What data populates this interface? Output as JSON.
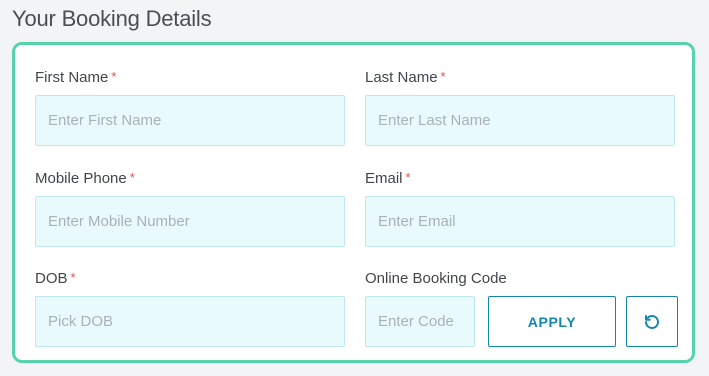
{
  "page": {
    "title": "Your Booking Details"
  },
  "form": {
    "required_marker": "*",
    "first_name": {
      "label": "First Name",
      "placeholder": "Enter First Name",
      "required": true
    },
    "last_name": {
      "label": "Last Name",
      "placeholder": "Enter Last Name",
      "required": true
    },
    "mobile_phone": {
      "label": "Mobile Phone",
      "placeholder": "Enter Mobile Number",
      "required": true
    },
    "email": {
      "label": "Email",
      "placeholder": "Enter Email",
      "required": true
    },
    "dob": {
      "label": "DOB",
      "placeholder": "Pick DOB",
      "required": true
    },
    "booking_code": {
      "label": "Online Booking Code",
      "placeholder": "Enter Code",
      "required": false
    },
    "apply_label": "APPLY",
    "reset_icon": "reset-icon"
  },
  "colors": {
    "card_border": "#55d3ad",
    "input_bg": "#e9fafd",
    "input_border": "#bfe8f1",
    "required_star": "#e74c4c",
    "button_primary": "#1286ad"
  }
}
